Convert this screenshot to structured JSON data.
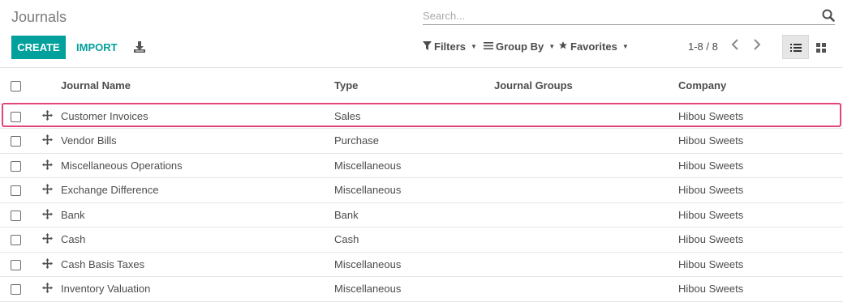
{
  "breadcrumb": {
    "title": "Journals"
  },
  "search": {
    "placeholder": "Search..."
  },
  "toolbar": {
    "create_label": "CREATE",
    "import_label": "IMPORT"
  },
  "search_options": {
    "filters_label": "Filters",
    "group_by_label": "Group By",
    "favorites_label": "Favorites"
  },
  "pager": {
    "value": "1-8 / 8"
  },
  "table": {
    "headers": {
      "journal_name": "Journal Name",
      "type": "Type",
      "journal_groups": "Journal Groups",
      "company": "Company"
    },
    "rows": [
      {
        "name": "Customer Invoices",
        "type": "Sales",
        "groups": "",
        "company": "Hibou Sweets"
      },
      {
        "name": "Vendor Bills",
        "type": "Purchase",
        "groups": "",
        "company": "Hibou Sweets"
      },
      {
        "name": "Miscellaneous Operations",
        "type": "Miscellaneous",
        "groups": "",
        "company": "Hibou Sweets"
      },
      {
        "name": "Exchange Difference",
        "type": "Miscellaneous",
        "groups": "",
        "company": "Hibou Sweets"
      },
      {
        "name": "Bank",
        "type": "Bank",
        "groups": "",
        "company": "Hibou Sweets"
      },
      {
        "name": "Cash",
        "type": "Cash",
        "groups": "",
        "company": "Hibou Sweets"
      },
      {
        "name": "Cash Basis Taxes",
        "type": "Miscellaneous",
        "groups": "",
        "company": "Hibou Sweets"
      },
      {
        "name": "Inventory Valuation",
        "type": "Miscellaneous",
        "groups": "",
        "company": "Hibou Sweets"
      }
    ]
  },
  "colors": {
    "primary": "#00a09d",
    "highlight": "#e0467a"
  },
  "icons": {
    "search": "search-icon",
    "download": "download-icon",
    "filter": "filter-icon",
    "group_by": "bars-icon",
    "favorites": "star-icon",
    "prev": "chevron-left-icon",
    "next": "chevron-right-icon",
    "list_view": "list-icon",
    "kanban_view": "grid-icon",
    "drag_handle": "move-arrows-icon"
  }
}
